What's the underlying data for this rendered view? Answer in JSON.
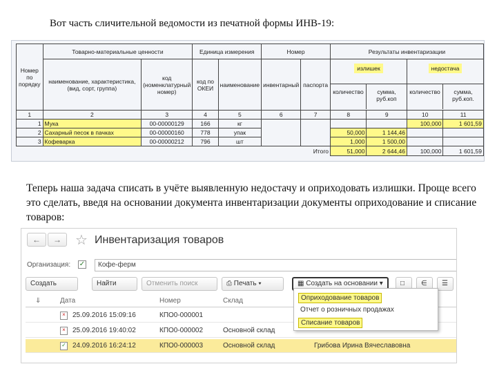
{
  "intro_top": "Вот часть сличительной ведомости из печатной формы ИНВ-19:",
  "inv_table": {
    "h_number": "Номер по порядку",
    "h_goods": "Товарно-материальные ценности",
    "h_unit": "Единица измерения",
    "h_nomer": "Номер",
    "h_result": "Результаты инвентаризации",
    "h_name": "наименование, характеристика, (вид, сорт, группа)",
    "h_code": "код (номенклатурный номер)",
    "h_okei": "код по ОКЕИ",
    "h_unitname": "наименование",
    "h_inv": "инвентарный",
    "h_pass": "паспорта",
    "h_surplus": "излишек",
    "h_shortage": "недостача",
    "h_qty1": "количество",
    "h_sum1": "сумма, руб.коп",
    "h_qty2": "количество",
    "h_sum2": "сумма, руб.коп.",
    "col_nums": [
      "1",
      "2",
      "3",
      "4",
      "5",
      "6",
      "7",
      "8",
      "9",
      "10",
      "11"
    ],
    "rows": [
      {
        "n": "1",
        "name": "Мука",
        "code": "00-00000129",
        "okei": "166",
        "unit": "кг",
        "s_qty": "",
        "s_sum": "",
        "d_qty": "100,000",
        "d_sum": "1 601,59"
      },
      {
        "n": "2",
        "name": "Сахарный песок в пачках",
        "code": "00-00000160",
        "okei": "778",
        "unit": "упак",
        "s_qty": "50,000",
        "s_sum": "1 144,46",
        "d_qty": "",
        "d_sum": ""
      },
      {
        "n": "3",
        "name": "Кофеварка",
        "code": "00-00000212",
        "okei": "796",
        "unit": "шт",
        "s_qty": "1,000",
        "s_sum": "1 500,00",
        "d_qty": "",
        "d_sum": ""
      }
    ],
    "total_label": "Итого",
    "total": {
      "s_qty": "51,000",
      "s_sum": "2 644,46",
      "d_qty": "100,000",
      "d_sum": "1 601,59"
    }
  },
  "intro_bottom": "Теперь наша задача списать в учёте выявленную недостачу и оприходовать излишки. Проще всего это сделать, введя на основании документа инвентаризации документы оприходование и списание товаров:",
  "app": {
    "title": "Инвентаризация товаров",
    "back_icon": "arrow-left-icon",
    "forward_icon": "arrow-right-icon",
    "org_label": "Организация:",
    "org_value": "Кофе-ферм",
    "toolbar": {
      "create": "Создать",
      "find": "Найти",
      "cancel_search": "Отменить поиск",
      "print": "Печать",
      "create_based": "Создать на основании"
    },
    "columns": {
      "date": "Дата",
      "number": "Номер",
      "warehouse": "Склад"
    },
    "rows": [
      {
        "date": "25.09.2016 15:09:16",
        "number": "КПО0-000001",
        "warehouse": "",
        "extra": ""
      },
      {
        "date": "25.09.2016 19:40:02",
        "number": "КПО0-000002",
        "warehouse": "Основной склад",
        "extra": ""
      },
      {
        "date": "24.09.2016 16:24:12",
        "number": "КПО0-000003",
        "warehouse": "Основной склад",
        "extra": "Грибова Ирина Вячеславовна"
      }
    ],
    "menu": {
      "item1": "Оприходование товаров",
      "item2": "Отчет о розничных продажах",
      "item3": "Списание товаров"
    },
    "colors": {
      "highlight": "#fff98a",
      "selected_row": "#fbeb9b"
    }
  }
}
